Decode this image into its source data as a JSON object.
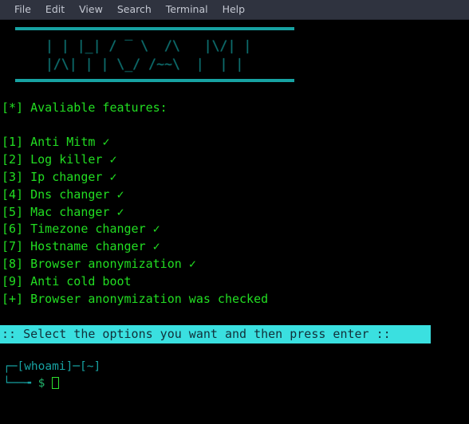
{
  "window": {
    "menu": [
      {
        "label": "File"
      },
      {
        "label": "Edit"
      },
      {
        "label": "View"
      },
      {
        "label": "Search"
      },
      {
        "label": "Terminal"
      },
      {
        "label": "Help"
      }
    ]
  },
  "terminal": {
    "banner": {
      "line1": "| | |_| / ‾ \\  /\\   |\\/| |",
      "line2": "|/\\| | | \\_/ /~~\\  |  | |"
    },
    "heading": "[*] Avaliable features:",
    "features": [
      {
        "index": "[1]",
        "label": "Anti Mitm",
        "mark": "✓"
      },
      {
        "index": "[2]",
        "label": "Log killer",
        "mark": "✓"
      },
      {
        "index": "[3]",
        "label": "Ip changer",
        "mark": "✓"
      },
      {
        "index": "[4]",
        "label": "Dns changer",
        "mark": "✓"
      },
      {
        "index": "[5]",
        "label": "Mac changer",
        "mark": "✓"
      },
      {
        "index": "[6]",
        "label": "Timezone changer",
        "mark": "✓"
      },
      {
        "index": "[7]",
        "label": "Hostname changer",
        "mark": "✓"
      },
      {
        "index": "[8]",
        "label": "Browser anonymization",
        "mark": "✓"
      },
      {
        "index": "[9]",
        "label": "Anti cold boot",
        "mark": ""
      }
    ],
    "status": "[+] Browser anonymization was checked",
    "select_bar": ":: Select the options you want and then press enter ::",
    "prompt": {
      "line1": "┌─[whoami]─[~]",
      "line2_prefix": "└──╼ ",
      "dollar": "$",
      "spacer": " "
    }
  },
  "colors": {
    "menu_bg": "#2f333f",
    "menu_text": "#c3c7d1",
    "terminal_bg": "#000000",
    "green": "#22dd22",
    "teal": "#17a2a2",
    "banner": "#0d6b6b",
    "select_bar_bg": "#3ae0e0",
    "select_bar_text": "#11303a",
    "cursor": "#2ee02e"
  }
}
